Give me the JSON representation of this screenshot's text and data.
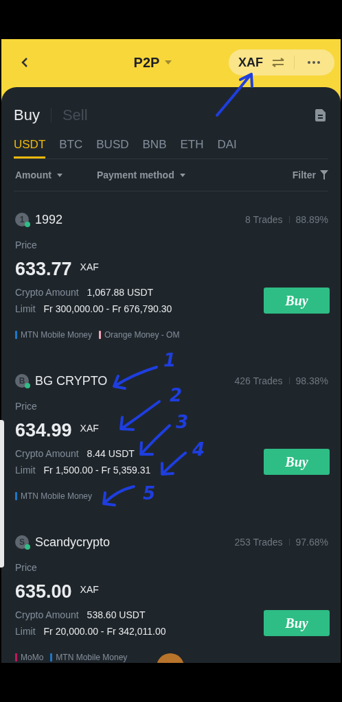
{
  "header": {
    "title": "P2P",
    "currency": "XAF"
  },
  "trade_tabs": [
    {
      "label": "Buy",
      "selected": true
    },
    {
      "label": "Sell",
      "selected": false
    }
  ],
  "asset_tabs": [
    {
      "label": "USDT",
      "selected": true
    },
    {
      "label": "BTC",
      "selected": false
    },
    {
      "label": "BUSD",
      "selected": false
    },
    {
      "label": "BNB",
      "selected": false
    },
    {
      "label": "ETH",
      "selected": false
    },
    {
      "label": "DAI",
      "selected": false
    }
  ],
  "filters": [
    {
      "label": "Amount",
      "kind": "dropdown"
    },
    {
      "label": "Payment method",
      "kind": "dropdown"
    },
    {
      "label": "Filter",
      "kind": "filter"
    }
  ],
  "offers": [
    {
      "avatar": "1",
      "online": true,
      "name": "1992",
      "trades": "8 Trades",
      "completion": "88.89%",
      "price_label": "Price",
      "price": "633.77",
      "currency": "XAF",
      "amount_label": "Crypto Amount",
      "amount": "1,067.88 USDT",
      "limit_label": "Limit",
      "limit": "Fr 300,000.00 - Fr 676,790.30",
      "button": "Buy",
      "payments": [
        {
          "name": "MTN Mobile Money",
          "color": "#1e78c8"
        },
        {
          "name": "Orange Money - OM",
          "color": "#f4a6b8"
        }
      ]
    },
    {
      "avatar": "B",
      "online": true,
      "name": "BG CRYPTO",
      "trades": "426 Trades",
      "completion": "98.38%",
      "price_label": "Price",
      "price": "634.99",
      "currency": "XAF",
      "amount_label": "Crypto Amount",
      "amount": "8.44 USDT",
      "limit_label": "Limit",
      "limit": "Fr 1,500.00 - Fr 5,359.31",
      "button": "Buy",
      "payments": [
        {
          "name": "MTN Mobile Money",
          "color": "#1e78c8"
        }
      ]
    },
    {
      "avatar": "S",
      "online": true,
      "name": "Scandycrypto",
      "trades": "253 Trades",
      "completion": "97.68%",
      "price_label": "Price",
      "price": "635.00",
      "currency": "XAF",
      "amount_label": "Crypto Amount",
      "amount": "538.60 USDT",
      "limit_label": "Limit",
      "limit": "Fr 20,000.00 - Fr 342,011.00",
      "button": "Buy",
      "payments": [
        {
          "name": "MoMo",
          "color": "#c2185b"
        },
        {
          "name": "MTN Mobile Money",
          "color": "#1e78c8"
        }
      ]
    }
  ],
  "annotations": [
    {
      "label": "1"
    },
    {
      "label": "2"
    },
    {
      "label": "3"
    },
    {
      "label": "4"
    },
    {
      "label": "5"
    }
  ]
}
